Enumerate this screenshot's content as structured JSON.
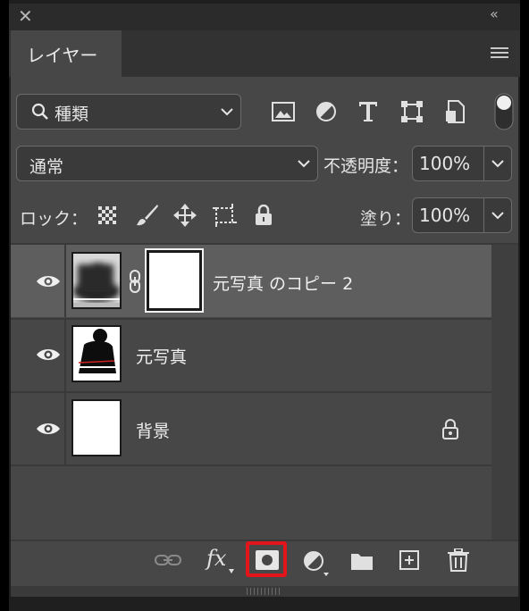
{
  "panel": {
    "tab_label": "レイヤー",
    "close_glyph": "✕",
    "collapse_glyph": "‹‹"
  },
  "filter": {
    "search_label": "種類",
    "icons": [
      "image-filter-icon",
      "adjustment-filter-icon",
      "type-filter-icon",
      "shape-filter-icon",
      "smart-object-filter-icon"
    ]
  },
  "blend": {
    "mode": "通常",
    "opacity_label": "不透明度：",
    "opacity_value": "100%",
    "fill_label": "塗り：",
    "fill_value": "100%",
    "lock_label": "ロック："
  },
  "layers": [
    {
      "name": "元写真 のコピー 2",
      "visible": true,
      "selected": true,
      "has_mask": true
    },
    {
      "name": "元写真",
      "visible": true,
      "selected": false,
      "has_mask": false
    },
    {
      "name": "背景",
      "visible": true,
      "selected": false,
      "has_mask": false,
      "locked": true
    }
  ],
  "bottom": {
    "fx_label": "fx",
    "highlight_color": "#e3151a"
  },
  "colors": {
    "panel_bg": "#474747",
    "selected_row": "#5e5e5e",
    "text": "#e6e6e6"
  }
}
